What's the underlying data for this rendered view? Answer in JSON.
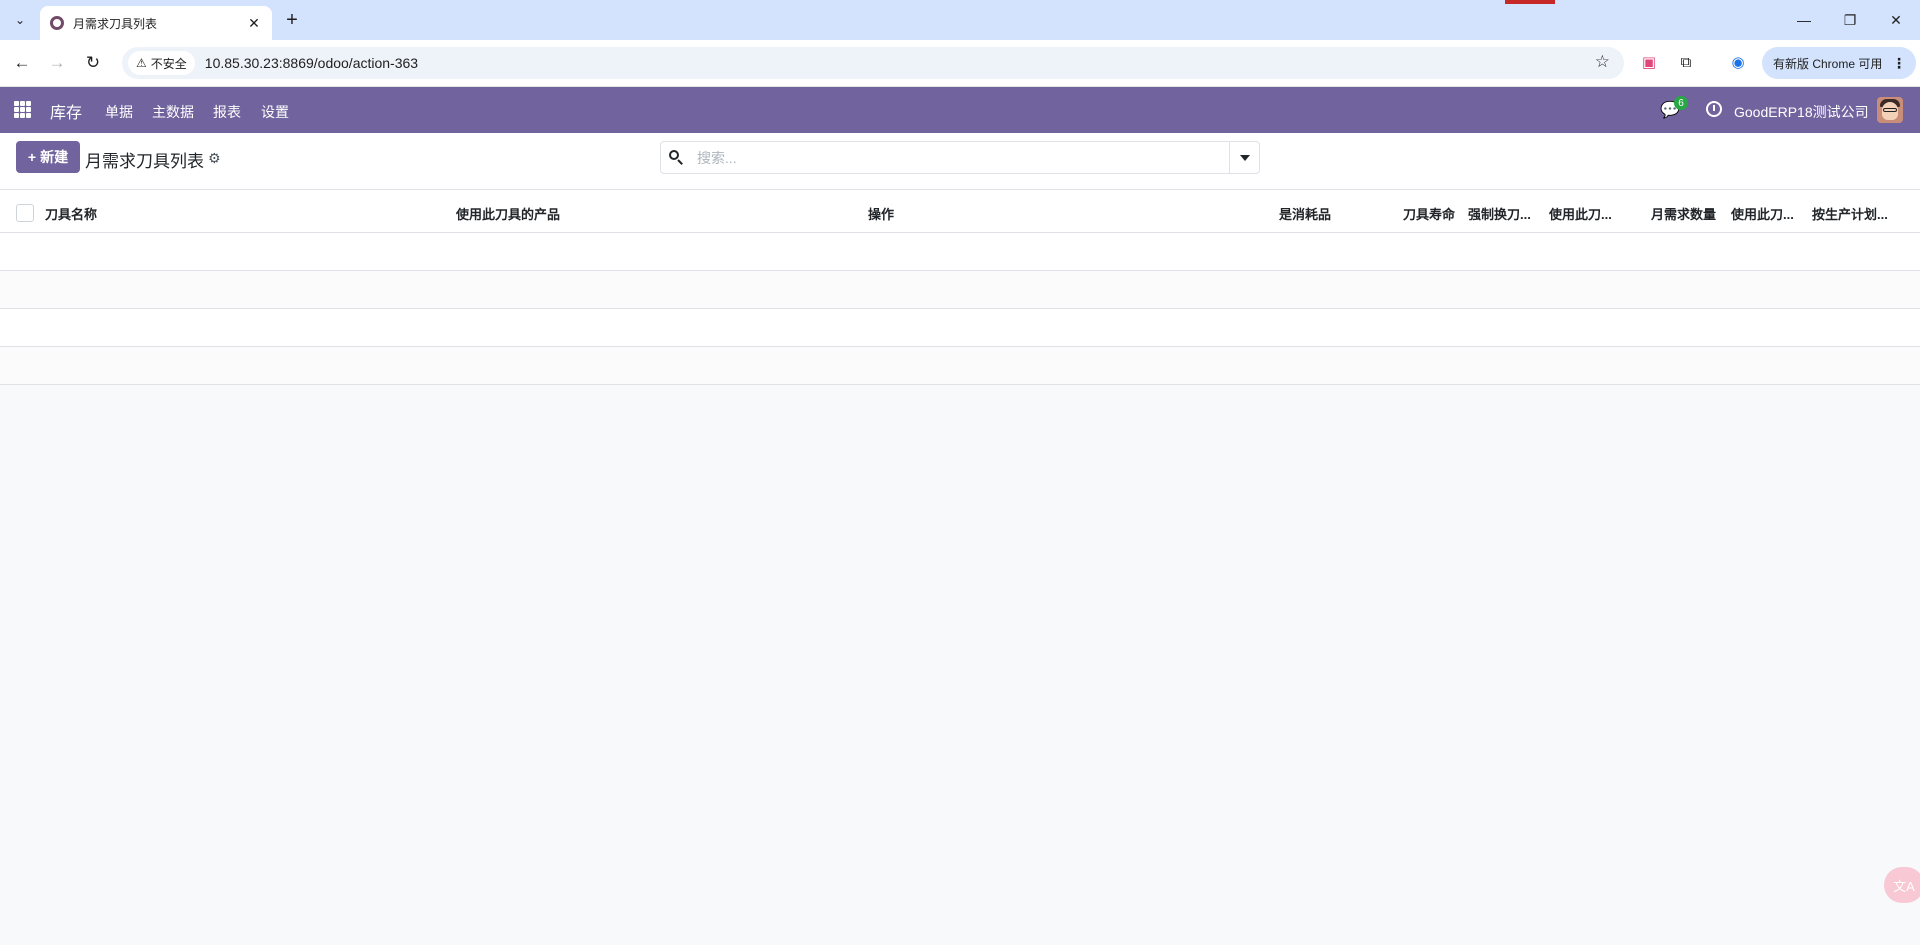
{
  "browser": {
    "tab_title": "月需求刀具列表",
    "security_label": "不安全",
    "url": "10.85.30.23:8869/odoo/action-363",
    "update_label": "有新版 Chrome 可用"
  },
  "navbar": {
    "app_name": "库存",
    "menu": [
      "单据",
      "主数据",
      "报表",
      "设置"
    ],
    "chat_count": "6",
    "company": "GoodERP18测试公司"
  },
  "control_panel": {
    "new_label": "新建",
    "title": "月需求刀具列表",
    "search_placeholder": "搜索..."
  },
  "list": {
    "columns": [
      "刀具名称",
      "使用此刀具的产品",
      "操作",
      "是消耗品",
      "刀具寿命",
      "强制换刀...",
      "使用此刀...",
      "月需求数量",
      "使用此刀...",
      "按生产计划..."
    ],
    "rows": []
  },
  "colors": {
    "brand": "#71639e",
    "tabstrip": "#d3e3fd"
  }
}
